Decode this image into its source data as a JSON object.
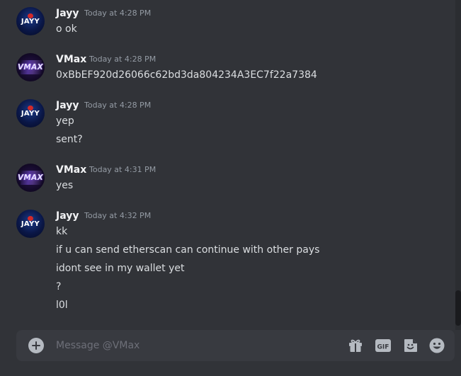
{
  "messages": [
    {
      "author": "Jayy",
      "avatar_text": "JAYY",
      "timestamp": "Today at 4:28 PM",
      "lines": [
        "o ok"
      ]
    },
    {
      "author": "VMax",
      "avatar_text": "VMAX",
      "timestamp": "Today at 4:28 PM",
      "lines": [
        "0xBbEF920d26066c62bd3da804234A3EC7f22a7384"
      ]
    },
    {
      "author": "Jayy",
      "avatar_text": "JAYY",
      "timestamp": "Today at 4:28 PM",
      "lines": [
        "yep",
        "sent?"
      ]
    },
    {
      "author": "VMax",
      "avatar_text": "VMAX",
      "timestamp": "Today at 4:31 PM",
      "lines": [
        "yes"
      ]
    },
    {
      "author": "Jayy",
      "avatar_text": "JAYY",
      "timestamp": "Today at 4:32 PM",
      "lines": [
        "kk",
        "if u can send etherscan can continue with other pays",
        "idont see in my wallet yet",
        "?",
        "l0l"
      ]
    }
  ],
  "composer": {
    "placeholder": "Message @VMax",
    "value": ""
  },
  "icons": {
    "add": "plus-circle-icon",
    "gift": "gift-icon",
    "gif": "gif-icon",
    "sticker": "sticker-icon",
    "emoji": "emoji-icon"
  },
  "colors": {
    "background": "#313338",
    "composer": "#383a40",
    "username": "#f2f3f5",
    "timestamp": "#949ba4",
    "text": "#dbdee1",
    "icon": "#b5bac1"
  }
}
